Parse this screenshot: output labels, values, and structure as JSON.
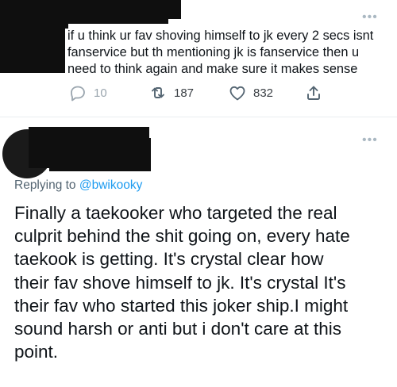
{
  "tweet1": {
    "text_lines": [
      "if u think ur fav shoving himself to jk every 2 secs isnt",
      "fanservice but th mentioning jk is fanservice then u",
      "need to think again and make sure it makes sense"
    ],
    "actions": {
      "reply_count": "10",
      "retweet_count": "187",
      "like_count": "832"
    }
  },
  "tweet2": {
    "reply_prefix": "Replying to ",
    "reply_handle": "@bwikooky",
    "text_lines": [
      "Finally a taekooker who targeted the real",
      "culprit behind the shit going on, every hate",
      "taekook is getting. It's crystal clear how",
      "their fav shove himself to jk. It's crystal It's",
      "their fav who started this joker ship.I might",
      "sound harsh or anti but i don't care at this",
      "point."
    ]
  },
  "colors": {
    "text": "#0f1419",
    "secondary": "#536471",
    "link": "#1d9bf0",
    "icon": "#536471"
  }
}
